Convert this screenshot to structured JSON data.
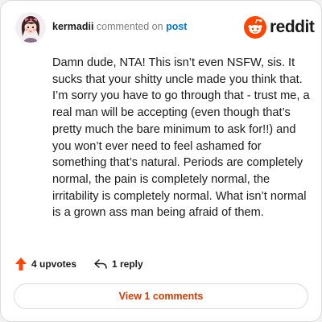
{
  "comment": {
    "author": "kermadii",
    "action_text": "commented on",
    "post_link": "post",
    "body": "Damn dude, NTA! This isn’t even NSFW, sis. It sucks that your shitty uncle made you think that. I’m sorry you have to go through that - trust me, a real man will be accepting (even though that’s pretty much the bare minimum to ask for!!) and you won’t ever need to feel ashamed for something that’s natural. Periods are completely normal, the pain is completely normal, the irritability is completely normal. What isn’t normal is a grown ass man being afraid of them."
  },
  "brand": {
    "name": "reddit",
    "icon": "reddit-logo-icon",
    "color": "#ff4500"
  },
  "actions": {
    "upvotes_label": "4 upvotes",
    "upvote_icon": "upvote-arrow-icon",
    "upvote_color": "#ff4500",
    "reply_label": "1 reply",
    "reply_icon": "reply-arrow-icon"
  },
  "footer": {
    "view_comments_label": "View 1 comments",
    "accent": "#d93a00"
  },
  "colors": {
    "link": "#0079d3",
    "text": "#1a1a1b",
    "muted": "#7c7c7c"
  }
}
